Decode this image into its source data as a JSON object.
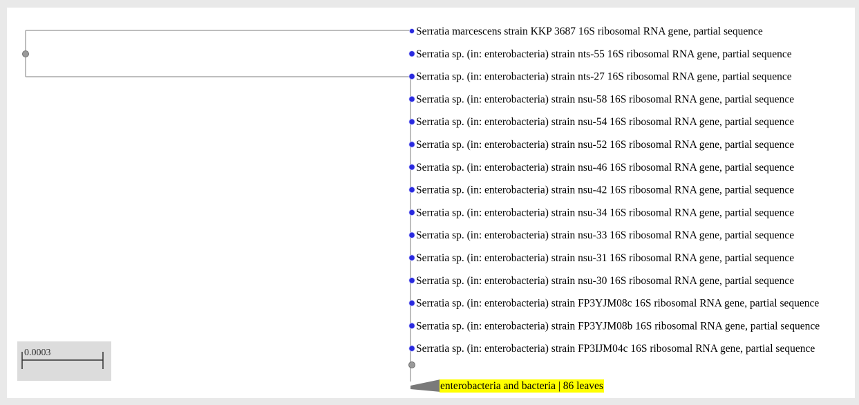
{
  "colors": {
    "branch": "#a8a8a8",
    "leaf_node": "#2a2adf",
    "internal_node": "#9a9a9a",
    "highlight": "#ffff00",
    "scale_box": "#dcdcdc"
  },
  "tree": {
    "leaves": [
      {
        "label": "Serratia marcescens strain KKP 3687 16S ribosomal RNA gene, partial sequence"
      },
      {
        "label": "Serratia sp. (in: enterobacteria) strain nts-55 16S ribosomal RNA gene, partial sequence"
      },
      {
        "label": "Serratia sp. (in: enterobacteria) strain nts-27 16S ribosomal RNA gene, partial sequence"
      },
      {
        "label": "Serratia sp. (in: enterobacteria) strain nsu-58 16S ribosomal RNA gene, partial sequence"
      },
      {
        "label": "Serratia sp. (in: enterobacteria) strain nsu-54 16S ribosomal RNA gene, partial sequence"
      },
      {
        "label": "Serratia sp. (in: enterobacteria) strain nsu-52 16S ribosomal RNA gene, partial sequence"
      },
      {
        "label": "Serratia sp. (in: enterobacteria) strain nsu-46 16S ribosomal RNA gene, partial sequence"
      },
      {
        "label": "Serratia sp. (in: enterobacteria) strain nsu-42 16S ribosomal RNA gene, partial sequence"
      },
      {
        "label": "Serratia sp. (in: enterobacteria) strain nsu-34 16S ribosomal RNA gene, partial sequence"
      },
      {
        "label": "Serratia sp. (in: enterobacteria) strain nsu-33 16S ribosomal RNA gene, partial sequence"
      },
      {
        "label": "Serratia sp. (in: enterobacteria) strain nsu-31 16S ribosomal RNA gene, partial sequence"
      },
      {
        "label": "Serratia sp. (in: enterobacteria) strain nsu-30 16S ribosomal RNA gene, partial sequence"
      },
      {
        "label": "Serratia sp. (in: enterobacteria) strain FP3YJM08c 16S ribosomal RNA gene, partial sequence"
      },
      {
        "label": "Serratia sp. (in: enterobacteria) strain FP3YJM08b 16S ribosomal RNA gene, partial sequence"
      },
      {
        "label": "Serratia sp. (in: enterobacteria) strain FP3IJM04c 16S ribosomal RNA gene, partial sequence"
      }
    ],
    "collapsed_group": {
      "label": "enterobacteria and bacteria | 86 leaves"
    }
  },
  "scale_bar": {
    "label": "0.0003"
  }
}
